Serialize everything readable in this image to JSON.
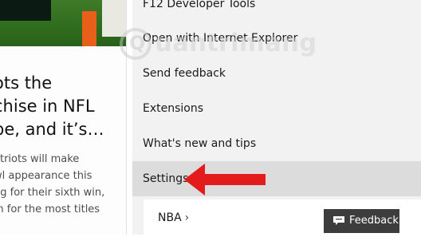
{
  "article": {
    "headline": "ots the\nchise in NFL\npe, and it’s…",
    "snippet": "atriots will make\nwl appearance this\nng for their sixth win,\nm for the most titles"
  },
  "menu": {
    "items": [
      "F12 Developer Tools",
      "Open with Internet Explorer",
      "Send feedback",
      "Extensions",
      "What's new and tips",
      "Settings"
    ],
    "selected": "Settings",
    "submenu_label": "NBA",
    "submenu_chevron": "›"
  },
  "watermark": {
    "mark": "Q",
    "text": "uantrimang"
  },
  "feedback_button": {
    "label": "Feedback",
    "icon": "chat-icon"
  },
  "colors": {
    "menu_bg": "#f2f2f2",
    "selected_bg": "#dcdcdc",
    "arrow": "#e31b1b",
    "feedback_bg": "#3d3d3d"
  }
}
